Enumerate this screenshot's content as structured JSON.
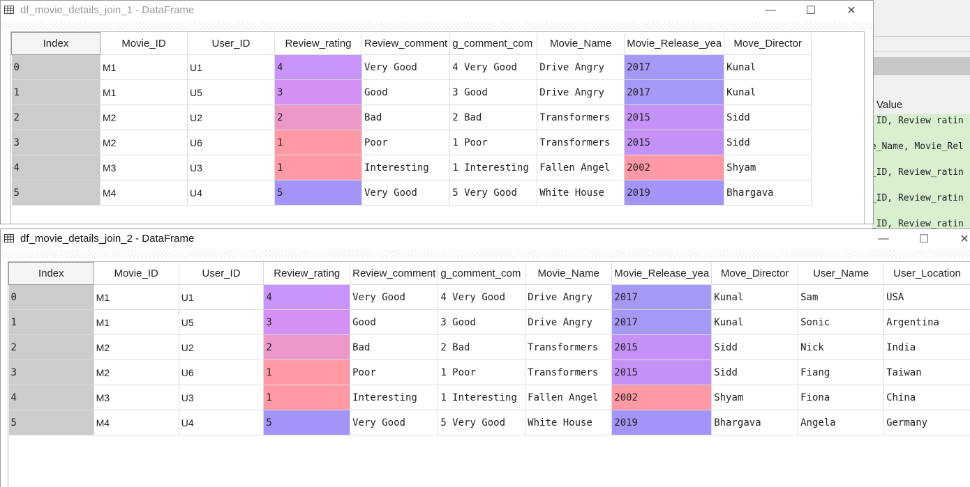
{
  "colors": {
    "rating": {
      "1": "#ff99a5",
      "2": "#ec98c8",
      "3": "#d490f5",
      "4": "#c994fa",
      "5": "#a394f7"
    },
    "year": {
      "2002": "#ff99a5",
      "2015": "#c492f7",
      "2017": "#a599f6",
      "2019": "#a394f7"
    },
    "index_bg": "#cccccc",
    "var_explorer_bg": "#d8efd0"
  },
  "background_app": {
    "value_header": "Value",
    "rows": [
      "r_ID, Review_ratin",
      "ie_Name, Movie_Rel",
      "r_ID, Review_ratin",
      "r_ID, Review_ratin",
      "r ID, Review ratin"
    ]
  },
  "window1": {
    "title": "df_movie_details_join_1 - DataFrame",
    "icon": "table-grid-icon",
    "controls": [
      "minimize-icon",
      "maximize-icon",
      "close-icon"
    ],
    "columns": [
      "Index",
      "Movie_ID",
      "User_ID",
      "Review_rating",
      "Review_comment",
      "g_comment_com",
      "Movie_Name",
      "Movie_Release_yea",
      "Move_Director"
    ],
    "rows": [
      {
        "index": "0",
        "Movie_ID": "M1",
        "User_ID": "U1",
        "Review_rating": "4",
        "Review_comment": "Very Good",
        "comment_com": "4 Very Good",
        "Movie_Name": "Drive Angry",
        "Release_year": "2017",
        "Director": "Kunal"
      },
      {
        "index": "1",
        "Movie_ID": "M1",
        "User_ID": "U5",
        "Review_rating": "3",
        "Review_comment": "Good",
        "comment_com": "3 Good",
        "Movie_Name": "Drive Angry",
        "Release_year": "2017",
        "Director": "Kunal"
      },
      {
        "index": "2",
        "Movie_ID": "M2",
        "User_ID": "U2",
        "Review_rating": "2",
        "Review_comment": "Bad",
        "comment_com": "2 Bad",
        "Movie_Name": "Transformers",
        "Release_year": "2015",
        "Director": "Sidd"
      },
      {
        "index": "3",
        "Movie_ID": "M2",
        "User_ID": "U6",
        "Review_rating": "1",
        "Review_comment": "Poor",
        "comment_com": "1 Poor",
        "Movie_Name": "Transformers",
        "Release_year": "2015",
        "Director": "Sidd"
      },
      {
        "index": "4",
        "Movie_ID": "M3",
        "User_ID": "U3",
        "Review_rating": "1",
        "Review_comment": "Interesting",
        "comment_com": "1 Interesting",
        "Movie_Name": "Fallen Angel",
        "Release_year": "2002",
        "Director": "Shyam"
      },
      {
        "index": "5",
        "Movie_ID": "M4",
        "User_ID": "U4",
        "Review_rating": "5",
        "Review_comment": "Very Good",
        "comment_com": "5 Very Good",
        "Movie_Name": "White House",
        "Release_year": "2019",
        "Director": "Bhargava"
      }
    ]
  },
  "window2": {
    "title": "df_movie_details_join_2 - DataFrame",
    "icon": "table-grid-icon",
    "controls": [
      "minimize-icon",
      "maximize-icon",
      "close-icon"
    ],
    "columns": [
      "Index",
      "Movie_ID",
      "User_ID",
      "Review_rating",
      "Review_comment",
      "g_comment_com",
      "Movie_Name",
      "Movie_Release_yea",
      "Move_Director",
      "User_Name",
      "User_Location"
    ],
    "rows": [
      {
        "index": "0",
        "Movie_ID": "M1",
        "User_ID": "U1",
        "Review_rating": "4",
        "Review_comment": "Very Good",
        "comment_com": "4 Very Good",
        "Movie_Name": "Drive Angry",
        "Release_year": "2017",
        "Director": "Kunal",
        "User_Name": "Sam",
        "User_Location": "USA"
      },
      {
        "index": "1",
        "Movie_ID": "M1",
        "User_ID": "U5",
        "Review_rating": "3",
        "Review_comment": "Good",
        "comment_com": "3 Good",
        "Movie_Name": "Drive Angry",
        "Release_year": "2017",
        "Director": "Kunal",
        "User_Name": "Sonic",
        "User_Location": "Argentina"
      },
      {
        "index": "2",
        "Movie_ID": "M2",
        "User_ID": "U2",
        "Review_rating": "2",
        "Review_comment": "Bad",
        "comment_com": "2 Bad",
        "Movie_Name": "Transformers",
        "Release_year": "2015",
        "Director": "Sidd",
        "User_Name": "Nick",
        "User_Location": "India"
      },
      {
        "index": "3",
        "Movie_ID": "M2",
        "User_ID": "U6",
        "Review_rating": "1",
        "Review_comment": "Poor",
        "comment_com": "1 Poor",
        "Movie_Name": "Transformers",
        "Release_year": "2015",
        "Director": "Sidd",
        "User_Name": "Fiang",
        "User_Location": "Taiwan"
      },
      {
        "index": "4",
        "Movie_ID": "M3",
        "User_ID": "U3",
        "Review_rating": "1",
        "Review_comment": "Interesting",
        "comment_com": "1 Interesting",
        "Movie_Name": "Fallen Angel",
        "Release_year": "2002",
        "Director": "Shyam",
        "User_Name": "Fiona",
        "User_Location": "China"
      },
      {
        "index": "5",
        "Movie_ID": "M4",
        "User_ID": "U4",
        "Review_rating": "5",
        "Review_comment": "Very Good",
        "comment_com": "5 Very Good",
        "Movie_Name": "White House",
        "Release_year": "2019",
        "Director": "Bhargava",
        "User_Name": "Angela",
        "User_Location": "Germany"
      }
    ]
  }
}
